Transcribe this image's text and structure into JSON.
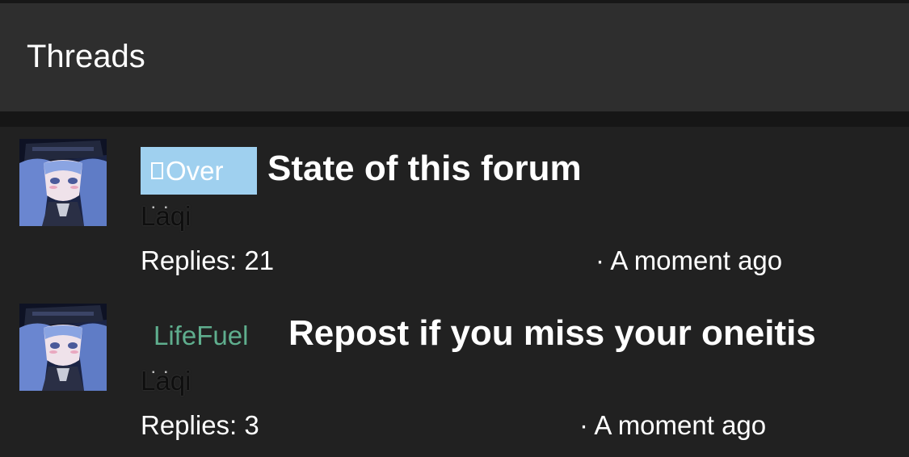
{
  "header": {
    "title": "Threads"
  },
  "threads": [
    {
      "tag": "Over",
      "tag_color": "#9fd0ef",
      "title": "State of this forum",
      "author": "Laqi",
      "replies": "Replies: 21",
      "time": "· A moment ago",
      "avatar_icon": "anime-avatar-icon"
    },
    {
      "tag": "LifeFuel",
      "tag_color": "#5fae8e",
      "title": "Repost if you miss your oneitis",
      "author": "Laqi",
      "replies": "Replies: 3",
      "time": "· A moment ago",
      "avatar_icon": "anime-avatar-icon"
    }
  ]
}
